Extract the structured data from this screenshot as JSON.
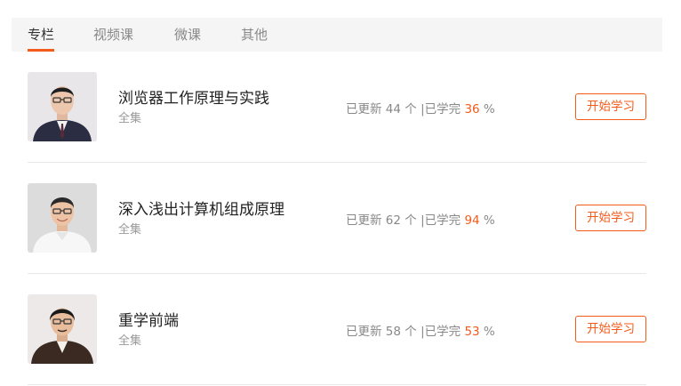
{
  "tabs": [
    {
      "label": "专栏",
      "active": true
    },
    {
      "label": "视频课",
      "active": false
    },
    {
      "label": "微课",
      "active": false
    },
    {
      "label": "其他",
      "active": false
    }
  ],
  "accent_color": "#f35b1b",
  "courses": [
    {
      "title": "浏览器工作原理与实践",
      "subtitle": "全集",
      "updated_prefix": "已更新",
      "updated_count": "44",
      "updated_unit": "个",
      "separator": "|",
      "learned_prefix": "已学完",
      "percent": "36",
      "percent_sign": "%",
      "button_label": "开始学习",
      "avatar_icon": "instructor-avatar"
    },
    {
      "title": "深入浅出计算机组成原理",
      "subtitle": "全集",
      "updated_prefix": "已更新",
      "updated_count": "62",
      "updated_unit": "个",
      "separator": "|",
      "learned_prefix": "已学完",
      "percent": "94",
      "percent_sign": "%",
      "button_label": "开始学习",
      "avatar_icon": "instructor-avatar"
    },
    {
      "title": "重学前端",
      "subtitle": "全集",
      "updated_prefix": "已更新",
      "updated_count": "58",
      "updated_unit": "个",
      "separator": "|",
      "learned_prefix": "已学完",
      "percent": "53",
      "percent_sign": "%",
      "button_label": "开始学习",
      "avatar_icon": "instructor-avatar"
    }
  ]
}
